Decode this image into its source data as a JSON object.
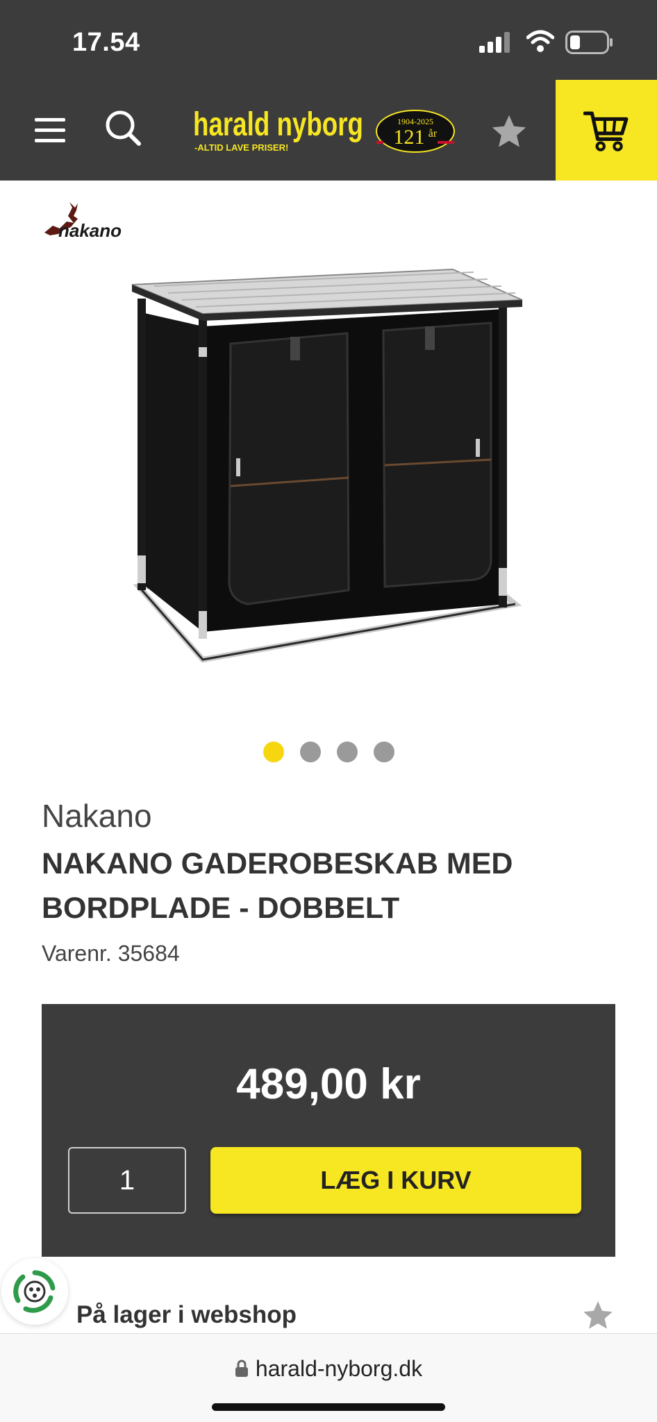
{
  "status_bar": {
    "time": "17.54",
    "icons": [
      "signal-icon",
      "wifi-icon",
      "battery-icon"
    ]
  },
  "header": {
    "logo_text": "harald nyborg",
    "logo_tagline": "-ALTID LAVE PRISER!",
    "anniversary_years": "1904-2025",
    "anniversary_number": "121",
    "anniversary_unit": "år",
    "icons": [
      "menu-icon",
      "search-icon",
      "star-icon",
      "cart-icon"
    ],
    "accent_color": "#f7e622",
    "bar_color": "#3c3c3c"
  },
  "product": {
    "brand_logo": "nakano",
    "brand": "Nakano",
    "title": "NAKANO GADEROBESKAB MED BORDPLADE - DOBBELT",
    "item_number": "Varenr. 35684",
    "image_count": 4,
    "active_image_index": 0
  },
  "buy_box": {
    "price": "489,00 kr",
    "quantity": "1",
    "add_to_cart_label": "LÆG I KURV"
  },
  "stock": {
    "label": "På lager i webshop"
  },
  "browser": {
    "url": "harald-nyborg.dk"
  }
}
